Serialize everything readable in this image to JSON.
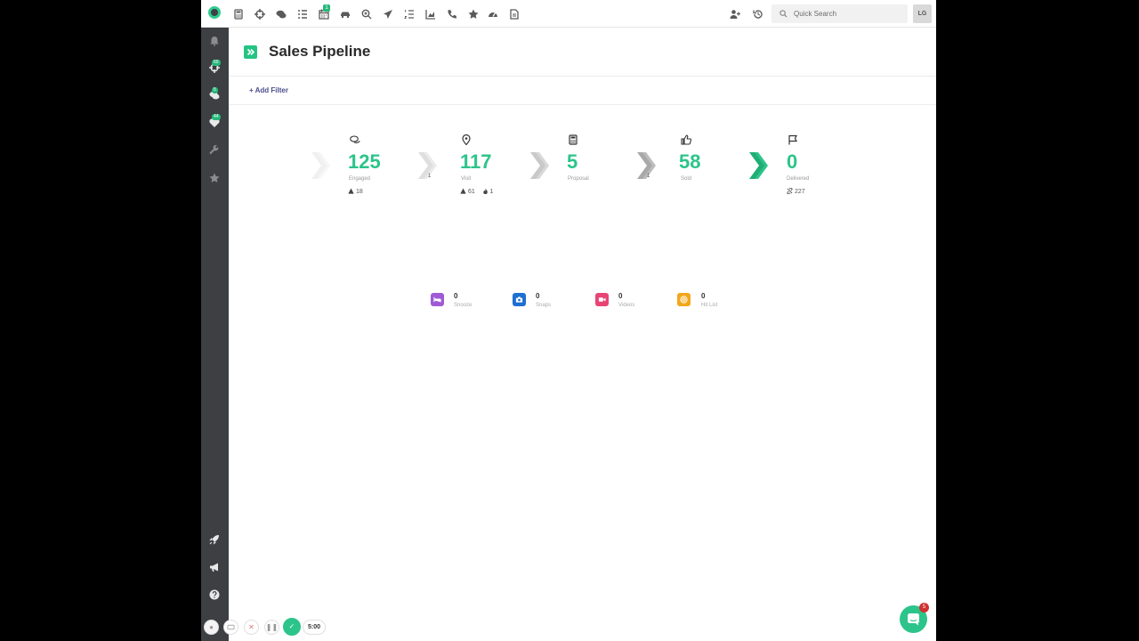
{
  "topbar": {
    "search_placeholder": "Quick Search",
    "avatar_initials": "LG",
    "calendar_badge": "1",
    "icons": [
      "calculator-icon",
      "crosshair-icon",
      "chat-icon",
      "list-icon",
      "calendar-icon",
      "car-icon",
      "zoom-icon",
      "send-icon",
      "ordered-list-icon",
      "chart-icon",
      "phone-icon",
      "star-icon",
      "dashboard-icon",
      "document-icon",
      "add-user-icon",
      "history-icon"
    ]
  },
  "sidebar": {
    "badges": {
      "crosshair": "60",
      "chat": "5",
      "heart": "44"
    }
  },
  "header": {
    "title": "Sales Pipeline"
  },
  "filter": {
    "add_label": "+ Add Filter"
  },
  "pipeline": {
    "stages": [
      {
        "label": "Engaged",
        "value": "125",
        "meta": "18",
        "icon": "chat-icon"
      },
      {
        "label": "Visit",
        "value": "117",
        "meta": "61",
        "meta2": "1",
        "icon": "location-icon"
      },
      {
        "label": "Proposal",
        "value": "5",
        "icon": "calculator-icon"
      },
      {
        "label": "Sold",
        "value": "58",
        "icon": "thumbs-up-icon"
      },
      {
        "label": "Delivered",
        "value": "0",
        "meta": "227",
        "icon": "flag-icon"
      }
    ],
    "arrow_counts": [
      "1",
      "1"
    ]
  },
  "tiles": [
    {
      "label": "Snooze",
      "value": "0",
      "color": "#a05ad6",
      "icon": "bed-icon"
    },
    {
      "label": "Snaps",
      "value": "0",
      "color": "#1d6fd0",
      "icon": "camera-icon"
    },
    {
      "label": "Videos",
      "value": "0",
      "color": "#e84474",
      "icon": "video-icon"
    },
    {
      "label": "Hit List",
      "value": "0",
      "color": "#f2a71b",
      "icon": "target-icon"
    }
  ],
  "controls": {
    "timer": "5:00"
  },
  "chat": {
    "badge": "5"
  },
  "colors": {
    "accent": "#2cc48a",
    "sidebar": "#3d3f43"
  }
}
